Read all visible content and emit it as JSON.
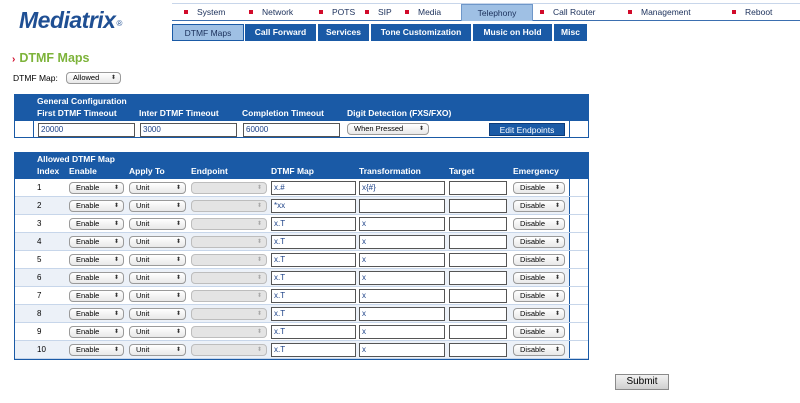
{
  "brand": {
    "name": "Mediatrix",
    "mark": "®"
  },
  "top_nav": [
    "System",
    "Network",
    "POTS",
    "SIP",
    "Media",
    "Telephony",
    "Call Router",
    "Management",
    "Reboot"
  ],
  "top_nav_active": "Telephony",
  "sub_nav": [
    "DTMF Maps",
    "Call Forward",
    "Services",
    "Tone Customization",
    "Music on Hold",
    "Misc"
  ],
  "sub_nav_active": "DTMF Maps",
  "page_title": "DTMF Maps",
  "dtmf_map": {
    "label": "DTMF Map:",
    "value": "Allowed"
  },
  "general": {
    "title": "General Configuration",
    "headers": [
      "First DTMF Timeout",
      "Inter DTMF Timeout",
      "Completion Timeout",
      "Digit Detection (FXS/FXO)"
    ],
    "first_timeout": "20000",
    "inter_timeout": "3000",
    "completion_timeout": "60000",
    "digit_detection": "When Pressed",
    "edit_endpoints": "Edit Endpoints"
  },
  "allowed": {
    "title": "Allowed DTMF Map",
    "headers": [
      "Index",
      "Enable",
      "Apply To",
      "Endpoint",
      "DTMF Map",
      "Transformation",
      "Target",
      "Emergency"
    ],
    "rows": [
      {
        "index": "1",
        "enable": "Enable",
        "apply": "Unit",
        "map": "x.#",
        "transform": "x{#}",
        "target": "",
        "emergency": "Disable"
      },
      {
        "index": "2",
        "enable": "Enable",
        "apply": "Unit",
        "map": "*xx",
        "transform": "",
        "target": "",
        "emergency": "Disable"
      },
      {
        "index": "3",
        "enable": "Enable",
        "apply": "Unit",
        "map": "x.T",
        "transform": "x",
        "target": "",
        "emergency": "Disable"
      },
      {
        "index": "4",
        "enable": "Enable",
        "apply": "Unit",
        "map": "x.T",
        "transform": "x",
        "target": "",
        "emergency": "Disable"
      },
      {
        "index": "5",
        "enable": "Enable",
        "apply": "Unit",
        "map": "x.T",
        "transform": "x",
        "target": "",
        "emergency": "Disable"
      },
      {
        "index": "6",
        "enable": "Enable",
        "apply": "Unit",
        "map": "x.T",
        "transform": "x",
        "target": "",
        "emergency": "Disable"
      },
      {
        "index": "7",
        "enable": "Enable",
        "apply": "Unit",
        "map": "x.T",
        "transform": "x",
        "target": "",
        "emergency": "Disable"
      },
      {
        "index": "8",
        "enable": "Enable",
        "apply": "Unit",
        "map": "x.T",
        "transform": "x",
        "target": "",
        "emergency": "Disable"
      },
      {
        "index": "9",
        "enable": "Enable",
        "apply": "Unit",
        "map": "x.T",
        "transform": "x",
        "target": "",
        "emergency": "Disable"
      },
      {
        "index": "10",
        "enable": "Enable",
        "apply": "Unit",
        "map": "x.T",
        "transform": "x",
        "target": "",
        "emergency": "Disable"
      }
    ]
  },
  "submit_label": "Submit",
  "colors": {
    "brand_blue": "#1a5aa6",
    "title_green": "#7db33a",
    "nav_red": "#d10a2a",
    "active_tab": "#9fc0e4"
  }
}
